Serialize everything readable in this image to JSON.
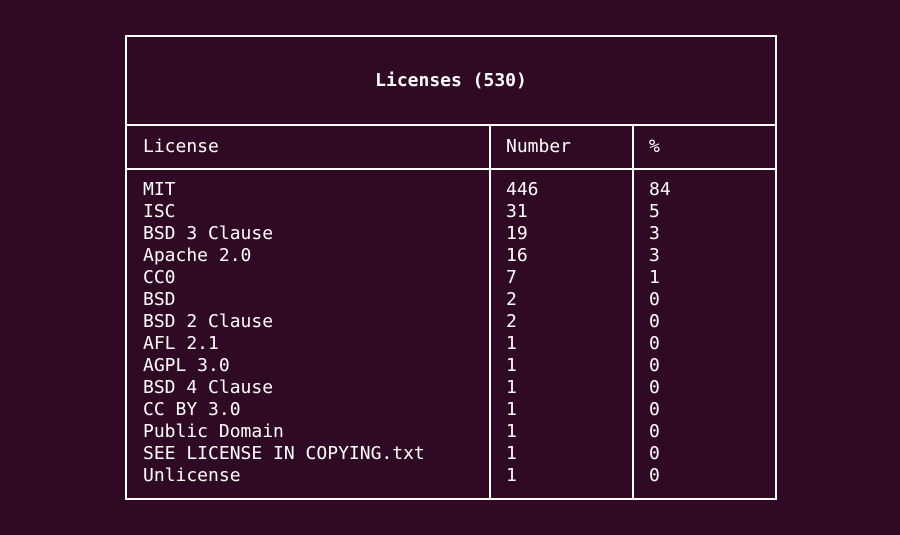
{
  "table": {
    "title": "Licenses (530)",
    "headers": {
      "license": "License",
      "number": "Number",
      "percent": "%"
    },
    "rows": [
      {
        "license": "MIT",
        "number": "446",
        "percent": "84"
      },
      {
        "license": "ISC",
        "number": "31",
        "percent": "5"
      },
      {
        "license": "BSD 3 Clause",
        "number": "19",
        "percent": "3"
      },
      {
        "license": "Apache 2.0",
        "number": "16",
        "percent": "3"
      },
      {
        "license": "CC0",
        "number": "7",
        "percent": "1"
      },
      {
        "license": "BSD",
        "number": "2",
        "percent": "0"
      },
      {
        "license": "BSD 2 Clause",
        "number": "2",
        "percent": "0"
      },
      {
        "license": "AFL 2.1",
        "number": "1",
        "percent": "0"
      },
      {
        "license": "AGPL 3.0",
        "number": "1",
        "percent": "0"
      },
      {
        "license": "BSD 4 Clause",
        "number": "1",
        "percent": "0"
      },
      {
        "license": "CC BY 3.0",
        "number": "1",
        "percent": "0"
      },
      {
        "license": "Public Domain",
        "number": "1",
        "percent": "0"
      },
      {
        "license": "SEE LICENSE IN COPYING.txt",
        "number": "1",
        "percent": "0"
      },
      {
        "license": "Unlicense",
        "number": "1",
        "percent": "0"
      }
    ]
  },
  "colors": {
    "background": "#300a24",
    "foreground": "#ffffff"
  }
}
